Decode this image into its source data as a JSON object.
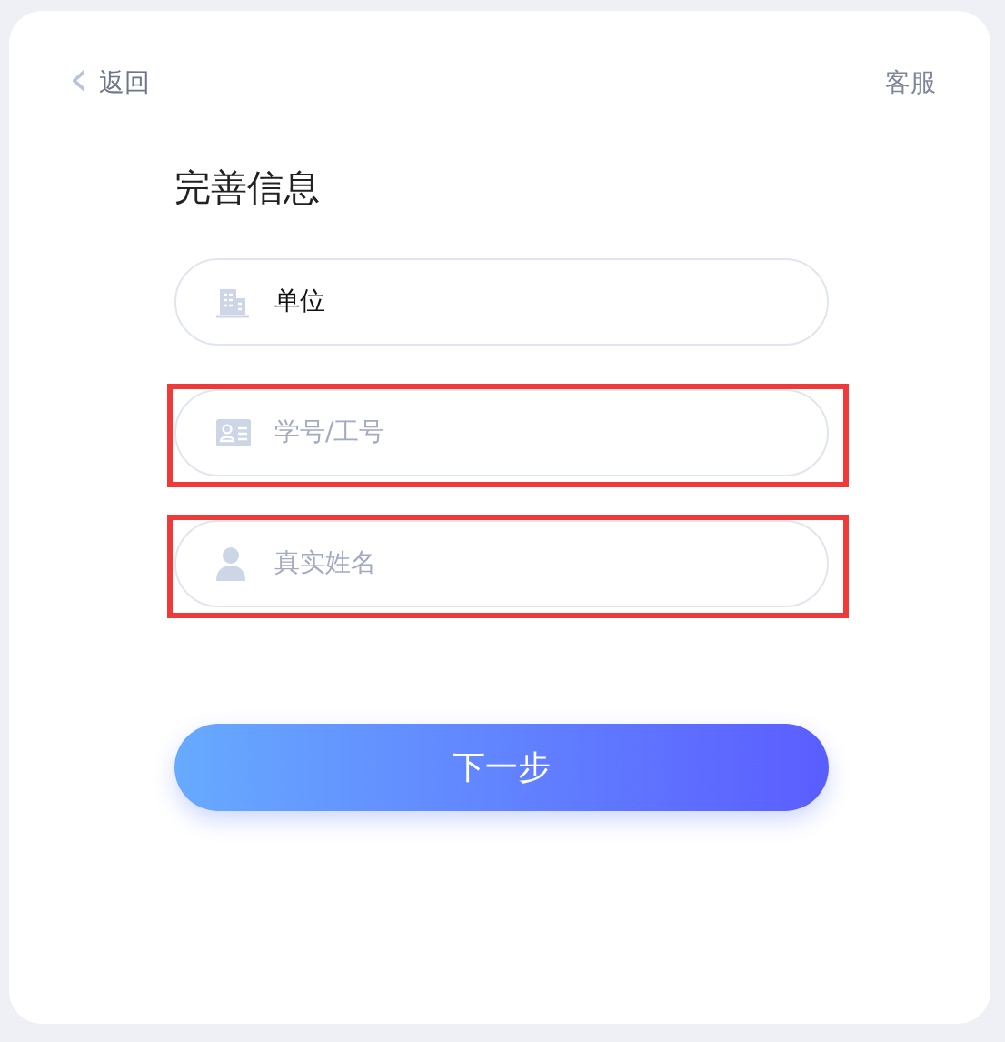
{
  "header": {
    "back": {
      "icon": "‹",
      "label": "返回"
    },
    "service": "客服"
  },
  "title": "完善信息",
  "fields": [
    {
      "value": "单位",
      "highlighted": false
    },
    {
      "placeholder": "学号/工号",
      "highlighted": true
    },
    {
      "placeholder": "真实姓名",
      "highlighted": true
    }
  ],
  "submit": "下一步"
}
